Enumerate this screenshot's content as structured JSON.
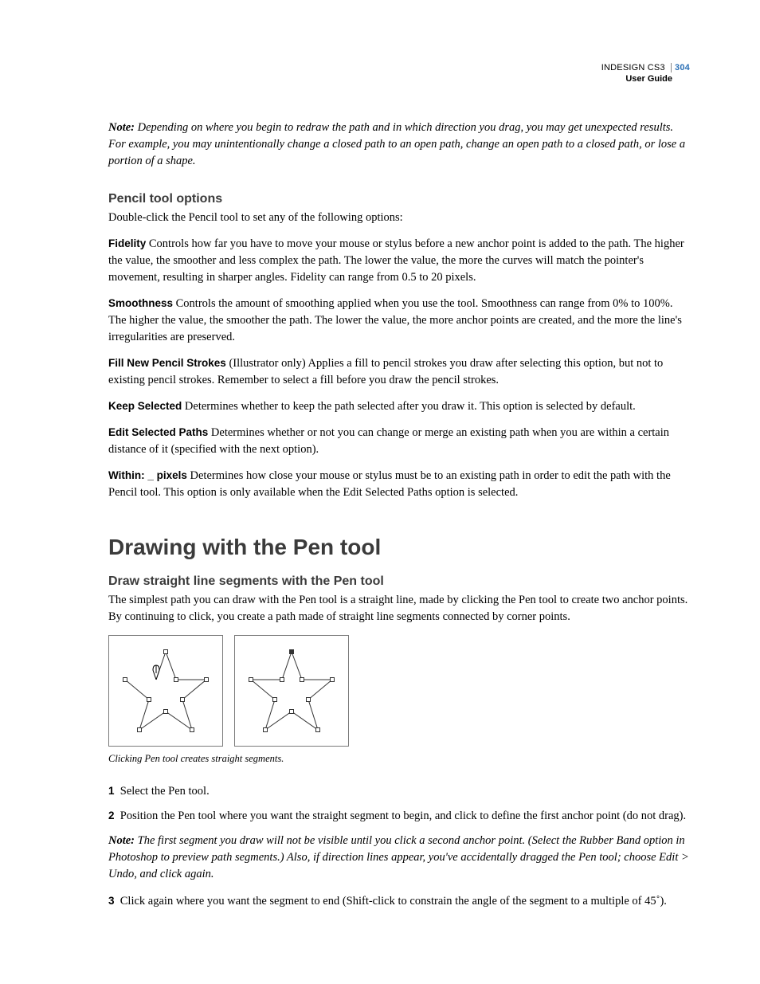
{
  "header": {
    "product": "INDESIGN CS3",
    "page_number": "304",
    "guide": "User Guide"
  },
  "note1": {
    "label": "Note:",
    "text": "Depending on where you begin to redraw the path and in which direction you drag, you may get unexpected results. For example, you may unintentionally change a closed path to an open path, change an open path to a closed path, or lose a portion of a shape."
  },
  "pencil": {
    "heading": "Pencil tool options",
    "intro": "Double-click the Pencil tool  to set any of the following options:",
    "fidelity": {
      "term": "Fidelity",
      "text": "Controls how far you have to move your mouse or stylus before a new anchor point is added to the path. The higher the value, the smoother and less complex the path. The lower the value, the more the curves will match the pointer's movement, resulting in sharper angles. Fidelity can range from 0.5 to 20 pixels."
    },
    "smoothness": {
      "term": "Smoothness",
      "text": "Controls the amount of smoothing applied when you use the tool. Smoothness can range from 0% to 100%. The higher the value, the smoother the path. The lower the value, the more anchor points are created, and the more the line's irregularities are preserved."
    },
    "fill": {
      "term": "Fill New Pencil Strokes",
      "text": "(Illustrator only) Applies a fill to pencil strokes you draw after selecting this option, but not to existing pencil strokes. Remember to select a fill before you draw the pencil strokes."
    },
    "keep": {
      "term": "Keep Selected",
      "text": "Determines whether to keep the path selected after you draw it. This option is selected by default."
    },
    "edit": {
      "term": "Edit Selected Paths",
      "text": "Determines whether or not you can change or merge an existing path when you are within a certain distance of it (specified with the next option)."
    },
    "within": {
      "term": "Within: _ pixels",
      "text": "Determines how close your mouse or stylus must be to an existing path in order to edit the path with the Pencil tool. This option is only available when the Edit Selected Paths option is selected."
    }
  },
  "pen": {
    "section": "Drawing with the Pen tool",
    "sub": "Draw straight line segments with the Pen tool",
    "intro": "The simplest path you can draw with the Pen tool is a straight line, made by clicking the Pen tool to create two anchor points. By continuing to click, you create a path made of straight line segments connected by corner points.",
    "caption": "Clicking Pen tool creates straight segments.",
    "step1": {
      "num": "1",
      "text": "Select the Pen tool."
    },
    "step2": {
      "num": "2",
      "text": "Position the Pen tool where you want the straight segment to begin, and click to define the first anchor point (do not drag)."
    },
    "note2": {
      "label": "Note:",
      "text": "The first segment you draw will not be visible until you click a second anchor point. (Select the Rubber Band option in Photoshop to preview path segments.) Also, if direction lines appear, you've accidentally dragged the Pen tool; choose Edit > Undo, and click again."
    },
    "step3": {
      "num": "3",
      "text": "Click again where you want the segment to end (Shift-click to constrain the angle of the segment to a multiple of 45˚)."
    }
  }
}
